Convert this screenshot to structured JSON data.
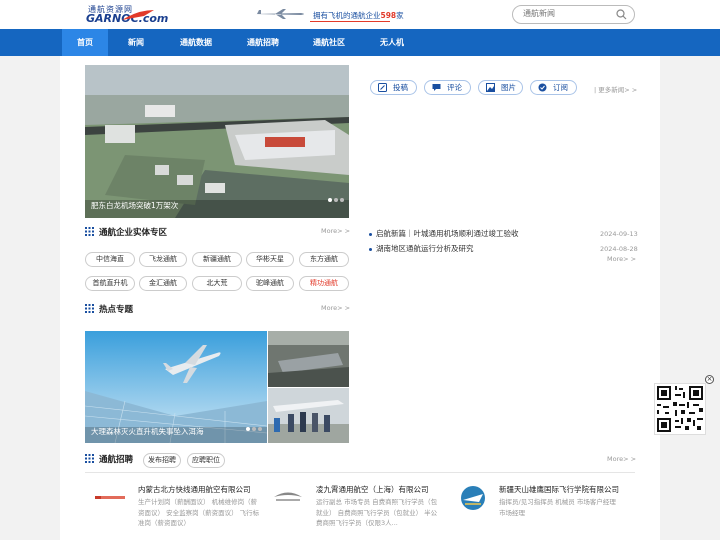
{
  "header": {
    "logo_cn": "通航资源网",
    "logo_en": "GARNOC.com",
    "slogan_prefix": "拥有飞机的通航企业",
    "slogan_count": "598",
    "slogan_suffix": "家",
    "search_placeholder": "通航新闻"
  },
  "nav": [
    "首页",
    "新闻",
    "通航数据",
    "通航招聘",
    "通航社区",
    "无人机"
  ],
  "hero": {
    "caption": "肥东白龙机场突破1万架次"
  },
  "news_actions": [
    "投稿",
    "评论",
    "图片",
    "订阅"
  ],
  "more_news": "| 更多新闻> >",
  "news": [
    {
      "title": "启航新篇｜叶城通用机场顺利通过竣工验收",
      "date": "2024-09-13"
    },
    {
      "title": "湖南地区通航运行分析及研究",
      "date": "2024-08-28"
    }
  ],
  "news_more": "More> >",
  "enterprise": {
    "title": "通航企业实体专区",
    "more": "More> >",
    "tags": [
      "中信海直",
      "飞龙通航",
      "新疆通航",
      "华彬天星",
      "东方通航",
      "首航直升机",
      "金汇通航",
      "北大荒",
      "驼峰通航",
      "精功通航"
    ],
    "highlight_color": "#e23a2a"
  },
  "hot": {
    "title": "热点专题",
    "more": "More> >",
    "caption": "大理森林灭火直升机失事坠入洱海"
  },
  "jobs": {
    "title": "通航招聘",
    "tags": [
      "发布招聘",
      "应聘职位"
    ],
    "more": "More> >",
    "items": [
      {
        "name": "内蒙古北方快线通用航空有限公司",
        "desc": "生产计划岗（薪酬面议） 机械维修岗（薪资面议） 安全监察岗（薪资面议） 飞行标准岗（薪资面议）"
      },
      {
        "name": "凌九霄通用航空（上海）有限公司",
        "desc": "运行副总 市场专员 自费商照飞行学员（包就业） 自费商照飞行学员（包就业） 半公费商照飞行学员（仅限3人..."
      },
      {
        "name": "新疆天山雄鹰国际飞行学院有限公司",
        "desc": "指挥员/见习指挥员 机械员 市场客户经理 市场经理"
      }
    ]
  },
  "colors": {
    "nav_bg": "#1566c0",
    "nav_active": "#2c86e6",
    "accent_red": "#e23a2a",
    "brand_blue": "#1a3f8f"
  }
}
